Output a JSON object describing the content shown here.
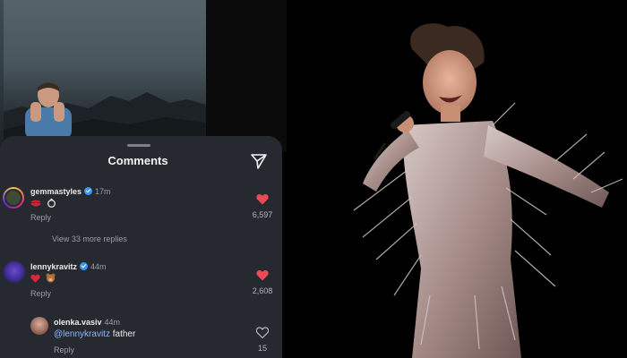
{
  "comments_panel": {
    "title": "Comments"
  },
  "comments": [
    {
      "username": "gemmastyles",
      "time": "17m",
      "reply_label": "Reply",
      "like_count": "6,597",
      "liked": true,
      "view_more": "View 33 more replies",
      "emoji": [
        "lips-icon",
        "ring-icon"
      ]
    },
    {
      "username": "lennykravitz",
      "time": "44m",
      "reply_label": "Reply",
      "like_count": "2,608",
      "liked": true,
      "emoji": [
        "red-heart-icon",
        "bear-icon"
      ]
    },
    {
      "username": "olenka.vasiv",
      "time": "44m",
      "mention": "@lennykravitz",
      "text": "father",
      "reply_label": "Reply",
      "like_count": "15",
      "liked": false
    }
  ],
  "colors": {
    "sheet_bg": "#262a30",
    "heart_red": "#ed4956",
    "verified_blue": "#3897f0",
    "mention_blue": "#8fb6ff"
  }
}
